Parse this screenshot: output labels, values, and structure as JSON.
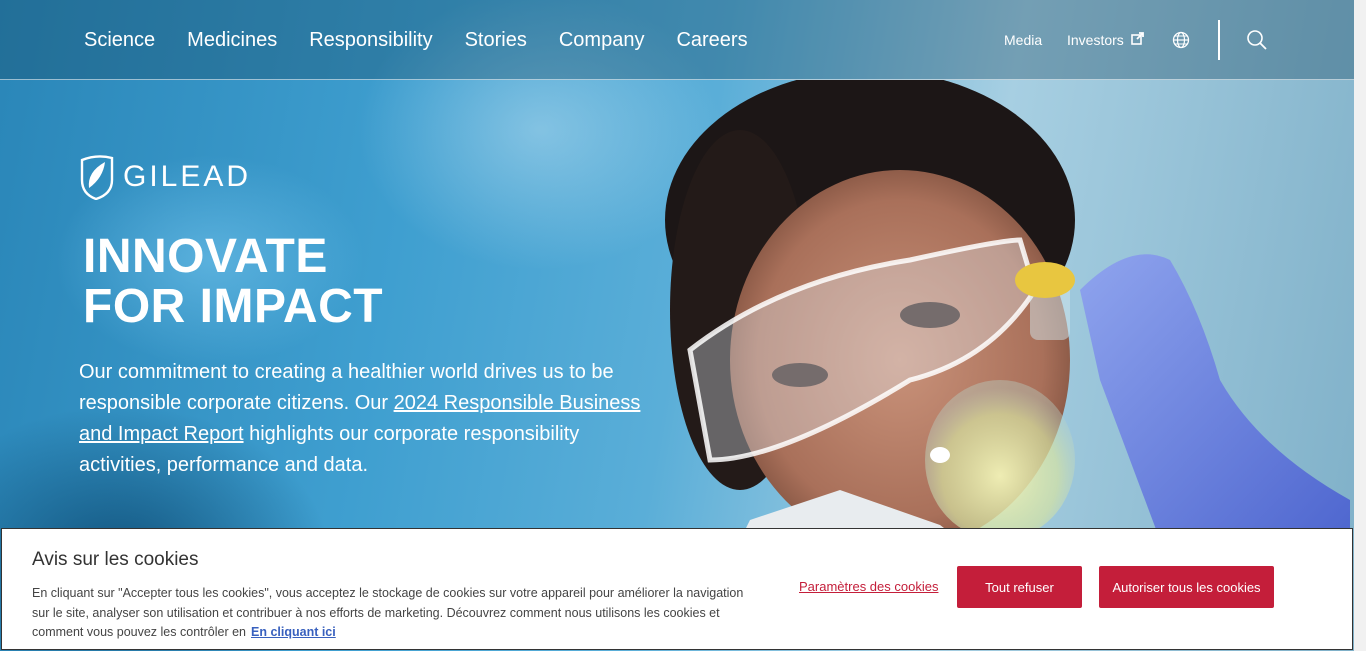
{
  "nav": {
    "items": [
      "Science",
      "Medicines",
      "Responsibility",
      "Stories",
      "Company",
      "Careers"
    ]
  },
  "utility": {
    "media": "Media",
    "investors": "Investors"
  },
  "brand": {
    "name": "GILEAD"
  },
  "hero": {
    "headline_line1": "INNOVATE",
    "headline_line2": "FOR IMPACT",
    "intro_before": "Our commitment to creating a healthier world drives us to be responsible corporate citizens. Our ",
    "intro_link": "2024 Responsible Business and Impact Report",
    "intro_after": " highlights our corporate responsibility activities, performance and data."
  },
  "cookie": {
    "title": "Avis sur les cookies",
    "body": "En cliquant sur \"Accepter tous les cookies\", vous acceptez le stockage de cookies sur votre appareil pour améliorer la navigation sur le site, analyser son utilisation et contribuer à nos efforts de marketing. Découvrez comment nous utilisons les cookies et comment vous pouvez les contrôler en",
    "link": "En cliquant ici",
    "settings": "Paramètres des cookies",
    "refuse": "Tout refuser",
    "accept": "Autoriser tous les cookies"
  },
  "colors": {
    "accent": "#c41e3a",
    "link": "#3860be"
  }
}
